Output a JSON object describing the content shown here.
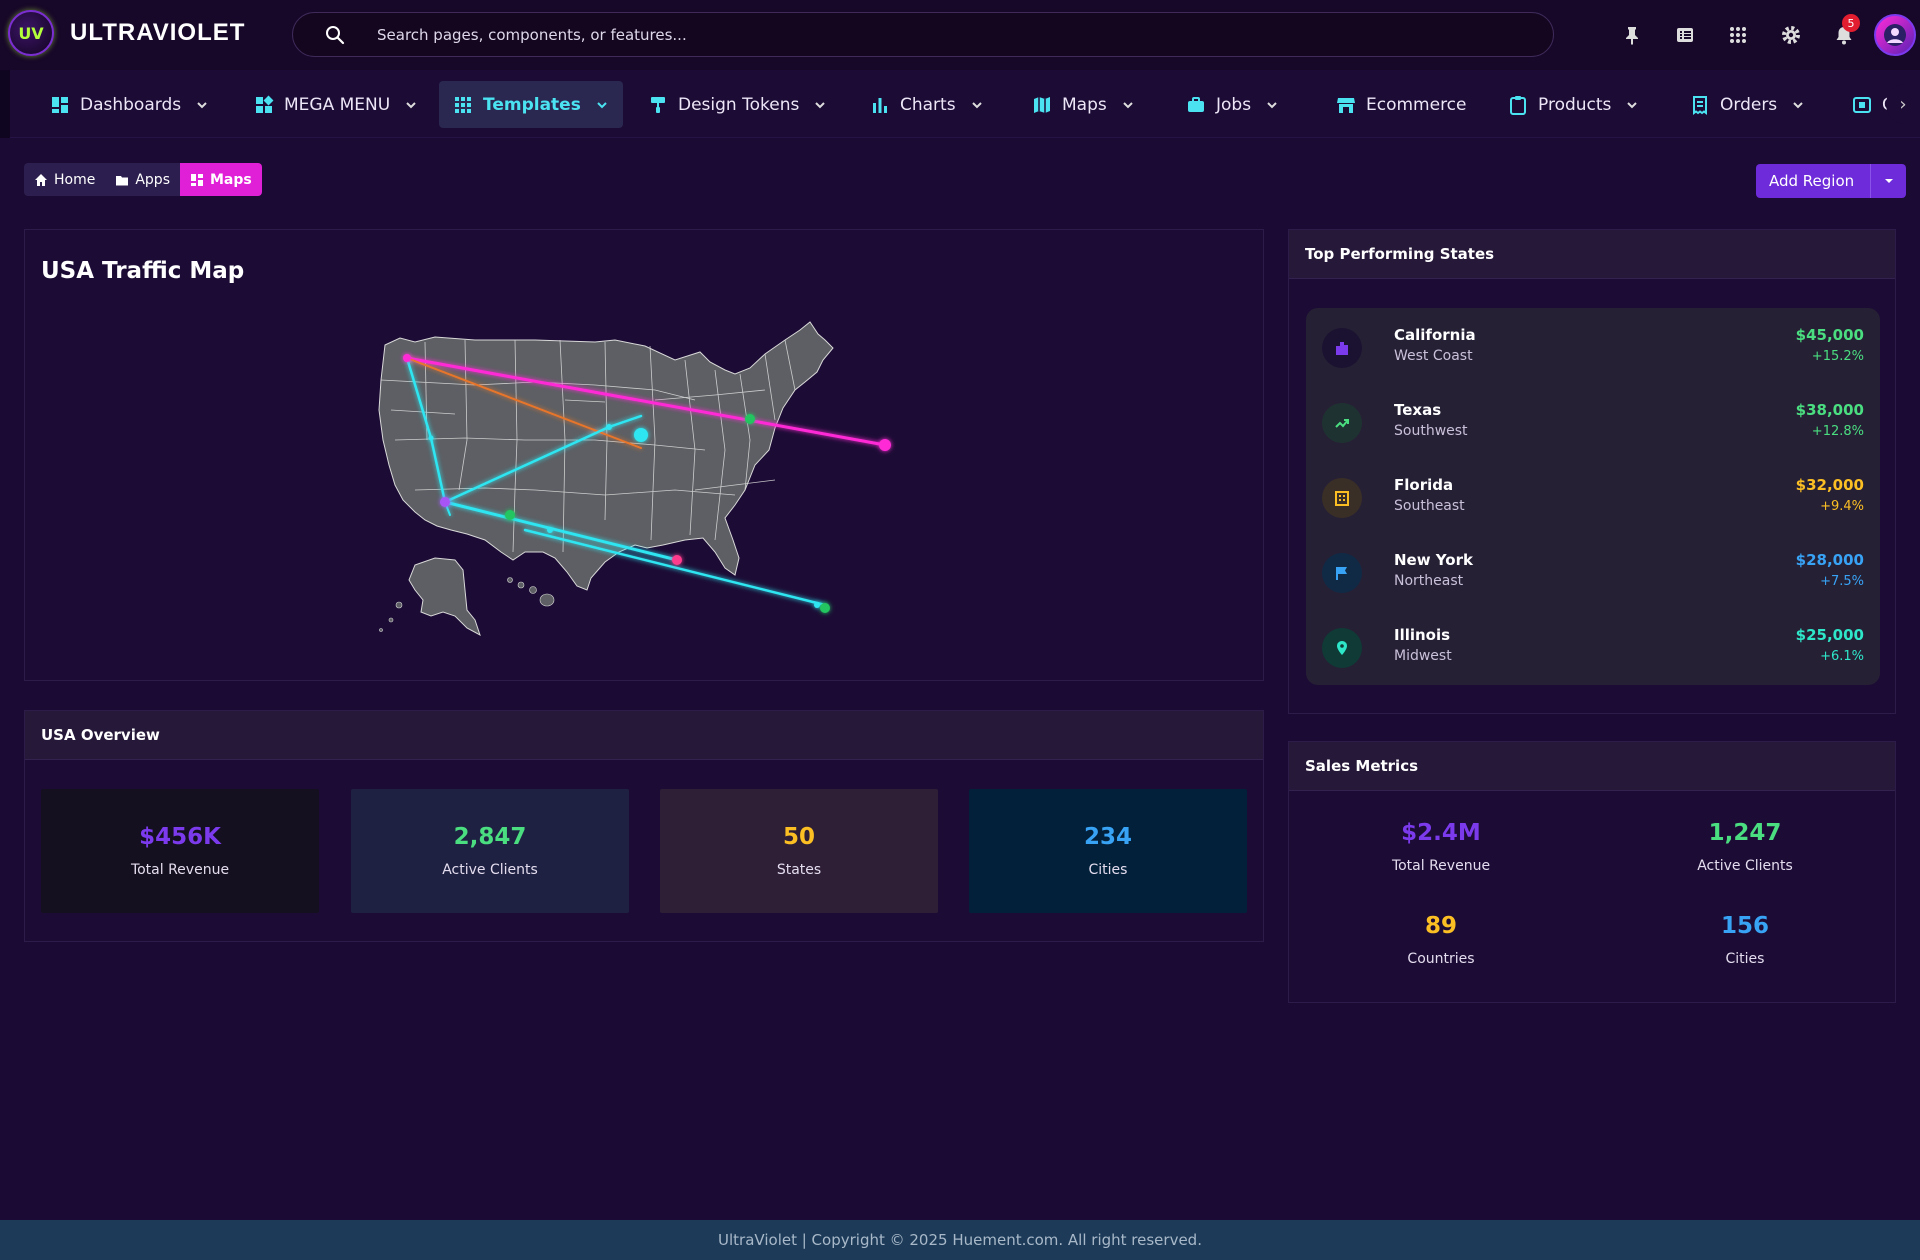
{
  "app": {
    "name": "ULTRAVIOLET",
    "logo_text": "UV",
    "notification_count": "5"
  },
  "search": {
    "placeholder": "Search pages, components, or features..."
  },
  "nav": {
    "items": [
      {
        "label": "Dashboards"
      },
      {
        "label": "MEGA MENU"
      },
      {
        "label": "Templates"
      },
      {
        "label": "Design Tokens"
      },
      {
        "label": "Charts"
      },
      {
        "label": "Maps"
      },
      {
        "label": "Jobs"
      },
      {
        "label": "Ecommerce"
      },
      {
        "label": "Products"
      },
      {
        "label": "Orders"
      },
      {
        "label": "Cr"
      }
    ],
    "active": "Templates"
  },
  "breadcrumb": {
    "home": "Home",
    "apps": "Apps",
    "current": "Maps"
  },
  "actions": {
    "add_region": "Add Region"
  },
  "map": {
    "title": "USA Traffic Map"
  },
  "overview": {
    "title": "USA Overview",
    "stats": [
      {
        "value": "$456K",
        "label": "Total Revenue",
        "color": "#7c3aed"
      },
      {
        "value": "2,847",
        "label": "Active Clients",
        "color": "#4ade80"
      },
      {
        "value": "50",
        "label": "States",
        "color": "#fbbf24"
      },
      {
        "value": "234",
        "label": "Cities",
        "color": "#38a3f5"
      }
    ]
  },
  "top_states": {
    "title": "Top Performing States",
    "rows": [
      {
        "name": "California",
        "region": "West Coast",
        "amount": "$45,000",
        "change": "+15.2%",
        "color": "#4ade80",
        "icon": "building-icon"
      },
      {
        "name": "Texas",
        "region": "Southwest",
        "amount": "$38,000",
        "change": "+12.8%",
        "color": "#4ade80",
        "icon": "trending-up-icon"
      },
      {
        "name": "Florida",
        "region": "Southeast",
        "amount": "$32,000",
        "change": "+9.4%",
        "color": "#fbbf24",
        "icon": "office-building-icon"
      },
      {
        "name": "New York",
        "region": "Northeast",
        "amount": "$28,000",
        "change": "+7.5%",
        "color": "#38a3f5",
        "icon": "flag-icon"
      },
      {
        "name": "Illinois",
        "region": "Midwest",
        "amount": "$25,000",
        "change": "+6.1%",
        "color": "#2ee6c8",
        "icon": "map-pin-icon"
      }
    ]
  },
  "sales": {
    "title": "Sales Metrics",
    "metrics": [
      {
        "value": "$2.4M",
        "label": "Total Revenue",
        "color": "#7c3aed"
      },
      {
        "value": "1,247",
        "label": "Active Clients",
        "color": "#4ade80"
      },
      {
        "value": "89",
        "label": "Countries",
        "color": "#fbbf24"
      },
      {
        "value": "156",
        "label": "Cities",
        "color": "#38a3f5"
      }
    ]
  },
  "footer": {
    "text": "UltraViolet | Copyright © 2025 Huement.com. All right reserved."
  }
}
